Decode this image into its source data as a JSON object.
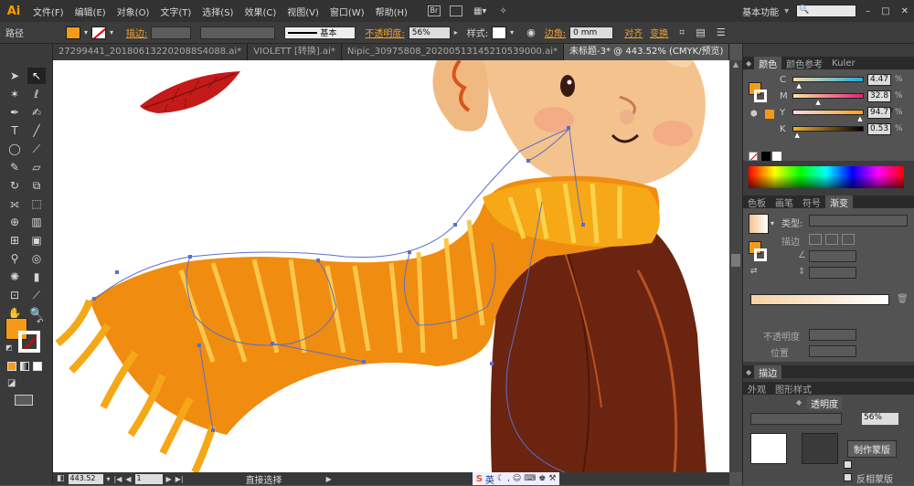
{
  "menubar": {
    "logo": "Ai",
    "items": [
      "文件(F)",
      "编辑(E)",
      "对象(O)",
      "文字(T)",
      "选择(S)",
      "效果(C)",
      "视图(V)",
      "窗口(W)",
      "帮助(H)"
    ],
    "workspace": "基本功能"
  },
  "control_bar": {
    "selection_label": "路径",
    "stroke_label": "描边:",
    "stroke_style": "基本",
    "opacity_label": "不透明度:",
    "opacity_value": "56%",
    "style_label": "样式:",
    "corner_label": "边角:",
    "corner_value": "0 mm",
    "align_label": "对齐",
    "transform_label": "变换",
    "fill_color": "#f39b18"
  },
  "doc_tabs": [
    {
      "label": "27299441_201806132202088S4088.ai*",
      "active": false
    },
    {
      "label": "VIOLETT [转换].ai*",
      "active": false
    },
    {
      "label": "Nipic_30975808_20200513145210539000.ai*",
      "active": false
    },
    {
      "label": "未标题-3* @ 443.52% (CMYK/预览)",
      "active": true
    }
  ],
  "color_panel": {
    "tabs": [
      "颜色",
      "颜色参考",
      "Kuler"
    ],
    "channels": [
      {
        "name": "C",
        "value": "4.47",
        "unit": "%",
        "pos": 0.045,
        "gradient": "linear-gradient(90deg,#f6d8a8,#24a8d8)"
      },
      {
        "name": "M",
        "value": "32.8",
        "unit": "%",
        "pos": 0.33,
        "gradient": "linear-gradient(90deg,#f7e8a0,#e8207a)"
      },
      {
        "name": "Y",
        "value": "94.77",
        "unit": "%",
        "pos": 0.95,
        "gradient": "linear-gradient(90deg,#f2d9e8,#f5a21a)"
      },
      {
        "name": "K",
        "value": "0.53",
        "unit": "%",
        "pos": 0.02,
        "gradient": "linear-gradient(90deg,#f8b02a,#000)"
      }
    ]
  },
  "gradient_panel": {
    "tabs": [
      "色板",
      "画笔",
      "符号",
      "渐变"
    ],
    "type_label": "类型:",
    "stroke_label": "描边",
    "opacity_label": "不透明度",
    "location_label": "位置"
  },
  "stroke_panel": {
    "title": "描边"
  },
  "appearance_panel": {
    "tabs": [
      "外观",
      "图形样式"
    ],
    "sub_tab": "透明度",
    "mode_value": "56%",
    "make_mask": "制作蒙版",
    "invert_mask": "反相蒙版"
  },
  "status_bar": {
    "zoom": "443.52",
    "page": "1",
    "tool_name": "直接选择"
  },
  "ime": {
    "label": "英"
  }
}
